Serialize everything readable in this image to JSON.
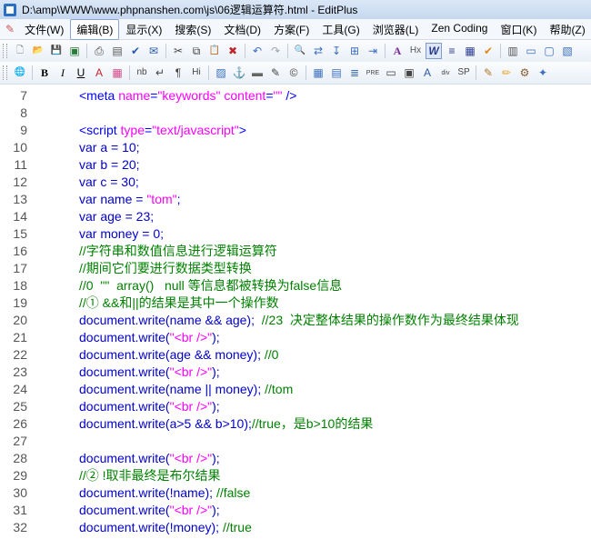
{
  "window": {
    "title": "D:\\amp\\WWW\\www.phpnanshen.com\\js\\06逻辑运算符.html - EditPlus"
  },
  "menu": {
    "items": [
      {
        "label": "文件(W)",
        "active": false
      },
      {
        "label": "编辑(B)",
        "active": true
      },
      {
        "label": "显示(X)",
        "active": false
      },
      {
        "label": "搜索(S)",
        "active": false
      },
      {
        "label": "文档(D)",
        "active": false
      },
      {
        "label": "方案(F)",
        "active": false
      },
      {
        "label": "工具(G)",
        "active": false
      },
      {
        "label": "浏览器(L)",
        "active": false
      },
      {
        "label": "Zen Coding",
        "active": false
      },
      {
        "label": "窗口(K)",
        "active": false
      },
      {
        "label": "帮助(Z)",
        "active": false
      }
    ]
  },
  "toolbar1": [
    {
      "icon": "new-file-icon",
      "glyph": "🗋",
      "color": "#ffffff"
    },
    {
      "icon": "open-folder-icon",
      "glyph": "📂",
      "color": "#e0a92a"
    },
    {
      "icon": "save-icon",
      "glyph": "💾",
      "color": "#2a7a3a"
    },
    {
      "icon": "save-all-icon",
      "glyph": "▣",
      "color": "#2a7a3a"
    },
    {
      "sep": true
    },
    {
      "icon": "print-icon",
      "glyph": "⎙",
      "color": "#444"
    },
    {
      "icon": "print-preview-icon",
      "glyph": "▤",
      "color": "#555"
    },
    {
      "icon": "spell-check-icon",
      "glyph": "✔",
      "color": "#2a5aa8"
    },
    {
      "icon": "send-icon",
      "glyph": "✉",
      "color": "#2a5aa8"
    },
    {
      "sep": true
    },
    {
      "icon": "cut-icon",
      "glyph": "✂",
      "color": "#444"
    },
    {
      "icon": "copy-icon",
      "glyph": "⧉",
      "color": "#444"
    },
    {
      "icon": "paste-icon",
      "glyph": "📋",
      "color": "#b07a2a"
    },
    {
      "icon": "delete-icon",
      "glyph": "✖",
      "color": "#c0262a"
    },
    {
      "sep": true
    },
    {
      "icon": "undo-icon",
      "glyph": "↶",
      "color": "#3a6fc0"
    },
    {
      "icon": "redo-icon",
      "glyph": "↷",
      "color": "#9aa6b5"
    },
    {
      "sep": true
    },
    {
      "icon": "find-icon",
      "glyph": "🔍",
      "color": "#444"
    },
    {
      "icon": "replace-icon",
      "glyph": "⇄",
      "color": "#3a6fc0"
    },
    {
      "icon": "goto-line-icon",
      "glyph": "↧",
      "color": "#3a6fc0"
    },
    {
      "icon": "find-files-icon",
      "glyph": "⊞",
      "color": "#3a6fc0"
    },
    {
      "icon": "goto-icon",
      "glyph": "⇥",
      "color": "#3a6fc0"
    },
    {
      "sep": true
    },
    {
      "icon": "font-icon",
      "glyph": "A",
      "color": "#7a2a9a"
    },
    {
      "icon": "hex-view-icon",
      "glyph": "Hx",
      "color": "#555"
    },
    {
      "icon": "word-wrap-icon",
      "glyph": "W",
      "color": "#2a3a8a",
      "sel": true
    },
    {
      "icon": "indent-icon",
      "glyph": "≡",
      "color": "#2a3a8a"
    },
    {
      "icon": "column-select-icon",
      "glyph": "▦",
      "color": "#2a3a8a"
    },
    {
      "icon": "check-mark-icon",
      "glyph": "✔",
      "color": "#e08a1a"
    },
    {
      "sep": true
    },
    {
      "icon": "list-icon",
      "glyph": "▥",
      "color": "#555"
    },
    {
      "icon": "window-icon",
      "glyph": "▭",
      "color": "#3a6fc0"
    },
    {
      "icon": "output-icon",
      "glyph": "▢",
      "color": "#3a6fc0"
    },
    {
      "icon": "cliptext-icon",
      "glyph": "▧",
      "color": "#3a6fc0"
    }
  ],
  "toolbar2": [
    {
      "icon": "browser-icon",
      "glyph": "🌐",
      "color": "#2a7ac0"
    },
    {
      "sep": true
    },
    {
      "icon": "bold-icon",
      "glyph": "B",
      "color": "#000"
    },
    {
      "icon": "italic-icon",
      "glyph": "I",
      "color": "#000"
    },
    {
      "icon": "underline-icon",
      "glyph": "U",
      "color": "#000"
    },
    {
      "icon": "font-color-icon",
      "glyph": "A",
      "color": "#c0262a"
    },
    {
      "icon": "color-palette-icon",
      "glyph": "▦",
      "color": "#d04a8a"
    },
    {
      "sep": true
    },
    {
      "icon": "nbsp-icon",
      "glyph": "nb",
      "color": "#444"
    },
    {
      "icon": "line-break-icon",
      "glyph": "↵",
      "color": "#444"
    },
    {
      "icon": "paragraph-icon",
      "glyph": "¶",
      "color": "#444"
    },
    {
      "icon": "heading-icon",
      "glyph": "Hi",
      "color": "#444"
    },
    {
      "sep": true
    },
    {
      "icon": "image-icon",
      "glyph": "▨",
      "color": "#3a6fc0"
    },
    {
      "icon": "anchor-icon",
      "glyph": "⚓",
      "color": "#b07a2a"
    },
    {
      "icon": "horizontal-rule-icon",
      "glyph": "▬",
      "color": "#666"
    },
    {
      "icon": "comment-icon",
      "glyph": "✎",
      "color": "#444"
    },
    {
      "icon": "special-char-icon",
      "glyph": "©",
      "color": "#444"
    },
    {
      "sep": true
    },
    {
      "icon": "table-icon",
      "glyph": "▦",
      "color": "#3a6fc0"
    },
    {
      "icon": "table-row-icon",
      "glyph": "▤",
      "color": "#3a6fc0"
    },
    {
      "icon": "center-icon",
      "glyph": "≣",
      "color": "#3a6fc0"
    },
    {
      "icon": "pre-icon",
      "glyph": "PRE",
      "color": "#444"
    },
    {
      "icon": "form-icon",
      "glyph": "▭",
      "color": "#444"
    },
    {
      "icon": "input-icon",
      "glyph": "▣",
      "color": "#444"
    },
    {
      "icon": "script-icon",
      "glyph": "A",
      "color": "#2a5aa8"
    },
    {
      "icon": "div-icon",
      "glyph": "div",
      "color": "#444"
    },
    {
      "icon": "span-icon",
      "glyph": "SP",
      "color": "#444"
    },
    {
      "sep": true
    },
    {
      "icon": "edit-tag-icon",
      "glyph": "✎",
      "color": "#b07a2a"
    },
    {
      "icon": "pencil-icon",
      "glyph": "✏",
      "color": "#e0a92a"
    },
    {
      "icon": "settings-icon",
      "glyph": "⚙",
      "color": "#8a5a2a"
    },
    {
      "icon": "wizard-icon",
      "glyph": "✦",
      "color": "#3a6fc0"
    }
  ],
  "code_lines": [
    {
      "num": "7",
      "indent": 4,
      "tokens": [
        {
          "c": "kw",
          "t": "<meta "
        },
        {
          "c": "str",
          "t": "name"
        },
        {
          "c": "kw",
          "t": "="
        },
        {
          "c": "str",
          "t": "\"keywords\""
        },
        {
          "c": "kw",
          "t": " "
        },
        {
          "c": "str",
          "t": "content"
        },
        {
          "c": "kw",
          "t": "="
        },
        {
          "c": "str",
          "t": "\"\""
        },
        {
          "c": "kw",
          "t": " />"
        }
      ]
    },
    {
      "num": "8",
      "indent": 0,
      "tokens": []
    },
    {
      "num": "9",
      "indent": 4,
      "tokens": [
        {
          "c": "kw",
          "t": "<script "
        },
        {
          "c": "str",
          "t": "type"
        },
        {
          "c": "kw",
          "t": "="
        },
        {
          "c": "str",
          "t": "\"text/javascript\""
        },
        {
          "c": "kw",
          "t": ">"
        }
      ]
    },
    {
      "num": "10",
      "indent": 4,
      "tokens": [
        {
          "c": "plain",
          "t": "var a = 10;"
        }
      ]
    },
    {
      "num": "11",
      "indent": 4,
      "tokens": [
        {
          "c": "plain",
          "t": "var b = 20;"
        }
      ]
    },
    {
      "num": "12",
      "indent": 4,
      "tokens": [
        {
          "c": "plain",
          "t": "var c = 30;"
        }
      ]
    },
    {
      "num": "13",
      "indent": 4,
      "tokens": [
        {
          "c": "plain",
          "t": "var name = "
        },
        {
          "c": "str",
          "t": "\"tom\""
        },
        {
          "c": "plain",
          "t": ";"
        }
      ]
    },
    {
      "num": "14",
      "indent": 4,
      "tokens": [
        {
          "c": "plain",
          "t": "var age = 23;"
        }
      ]
    },
    {
      "num": "15",
      "indent": 4,
      "tokens": [
        {
          "c": "plain",
          "t": "var money = 0;"
        }
      ]
    },
    {
      "num": "16",
      "indent": 4,
      "tokens": [
        {
          "c": "cm",
          "t": "//字符串和数值信息进行逻辑运算符"
        }
      ]
    },
    {
      "num": "17",
      "indent": 4,
      "tokens": [
        {
          "c": "cm",
          "t": "//期间它们要进行数据类型转换"
        }
      ]
    },
    {
      "num": "18",
      "indent": 4,
      "tokens": [
        {
          "c": "cm",
          "t": "//0  \"\"  array()   null 等信息都被转换为false信息"
        }
      ]
    },
    {
      "num": "19",
      "indent": 4,
      "tokens": [
        {
          "c": "cm",
          "t": "//① &&和||的结果是其中一个操作数"
        }
      ]
    },
    {
      "num": "20",
      "indent": 4,
      "tokens": [
        {
          "c": "plain",
          "t": "document.write(name && age);  "
        },
        {
          "c": "cm",
          "t": "//23  决定整体结果的操作数作为最终结果体现"
        }
      ]
    },
    {
      "num": "21",
      "indent": 4,
      "tokens": [
        {
          "c": "plain",
          "t": "document.write("
        },
        {
          "c": "str",
          "t": "\"<br />\""
        },
        {
          "c": "plain",
          "t": ");"
        }
      ]
    },
    {
      "num": "22",
      "indent": 4,
      "tokens": [
        {
          "c": "plain",
          "t": "document.write(age && money); "
        },
        {
          "c": "cm",
          "t": "//0"
        }
      ]
    },
    {
      "num": "23",
      "indent": 4,
      "tokens": [
        {
          "c": "plain",
          "t": "document.write("
        },
        {
          "c": "str",
          "t": "\"<br />\""
        },
        {
          "c": "plain",
          "t": ");"
        }
      ]
    },
    {
      "num": "24",
      "indent": 4,
      "tokens": [
        {
          "c": "plain",
          "t": "document.write(name || money); "
        },
        {
          "c": "cm",
          "t": "//tom"
        }
      ]
    },
    {
      "num": "25",
      "indent": 4,
      "tokens": [
        {
          "c": "plain",
          "t": "document.write("
        },
        {
          "c": "str",
          "t": "\"<br />\""
        },
        {
          "c": "plain",
          "t": ");"
        }
      ]
    },
    {
      "num": "26",
      "indent": 4,
      "tokens": [
        {
          "c": "plain",
          "t": "document.write(a>5 && b>10);"
        },
        {
          "c": "cm",
          "t": "//true，是b>10的结果"
        }
      ]
    },
    {
      "num": "27",
      "indent": 0,
      "tokens": []
    },
    {
      "num": "28",
      "indent": 4,
      "tokens": [
        {
          "c": "plain",
          "t": "document.write("
        },
        {
          "c": "str",
          "t": "\"<br />\""
        },
        {
          "c": "plain",
          "t": ");"
        }
      ]
    },
    {
      "num": "29",
      "indent": 4,
      "tokens": [
        {
          "c": "cm",
          "t": "//② !取非最终是布尔结果"
        }
      ]
    },
    {
      "num": "30",
      "indent": 4,
      "tokens": [
        {
          "c": "plain",
          "t": "document.write(!name); "
        },
        {
          "c": "cm",
          "t": "//false"
        }
      ]
    },
    {
      "num": "31",
      "indent": 4,
      "tokens": [
        {
          "c": "plain",
          "t": "document.write("
        },
        {
          "c": "str",
          "t": "\"<br />\""
        },
        {
          "c": "plain",
          "t": ");"
        }
      ]
    },
    {
      "num": "32",
      "indent": 4,
      "tokens": [
        {
          "c": "plain",
          "t": "document.write(!money); "
        },
        {
          "c": "cm",
          "t": "//true"
        }
      ]
    }
  ]
}
